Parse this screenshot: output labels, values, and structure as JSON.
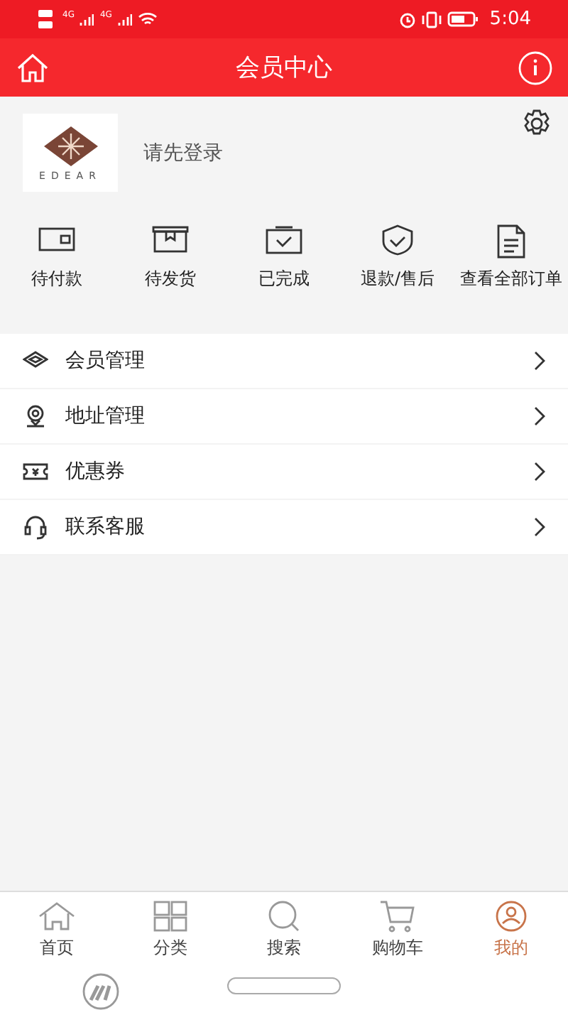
{
  "status_bar": {
    "networks": [
      "4G",
      "4G"
    ],
    "time": "5:04"
  },
  "header": {
    "title": "会员中心"
  },
  "profile": {
    "login_prompt": "请先登录",
    "logo_text": "EDEAR"
  },
  "orders": [
    {
      "kind": "wallet",
      "label": "待付款"
    },
    {
      "kind": "box",
      "label": "待发货"
    },
    {
      "kind": "done",
      "label": "已完成"
    },
    {
      "kind": "shield",
      "label": "退款/售后"
    },
    {
      "kind": "doc",
      "label": "查看全部订单"
    }
  ],
  "menu": [
    {
      "kind": "diamond",
      "label": "会员管理"
    },
    {
      "kind": "pin",
      "label": "地址管理"
    },
    {
      "kind": "coupon",
      "label": "优惠券"
    },
    {
      "kind": "headset",
      "label": "联系客服"
    }
  ],
  "tab_bar": [
    {
      "kind": "home",
      "label": "首页",
      "selected": false
    },
    {
      "kind": "grid",
      "label": "分类",
      "selected": false
    },
    {
      "kind": "search",
      "label": "搜索",
      "selected": false
    },
    {
      "kind": "cart",
      "label": "购物车",
      "selected": false
    },
    {
      "kind": "user",
      "label": "我的",
      "selected": true
    }
  ]
}
